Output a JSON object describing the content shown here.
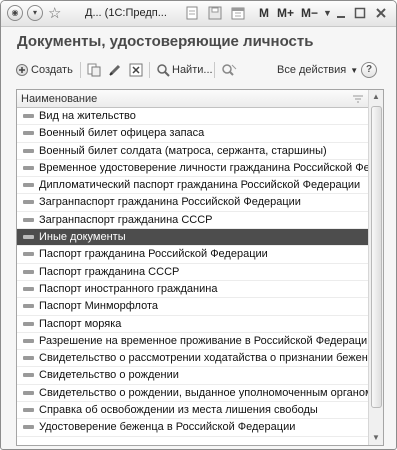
{
  "titlebar": {
    "title": "Д...  (1С:Предп...",
    "m_label": "M",
    "m_plus_label": "M+",
    "m_minus_label": "M−"
  },
  "heading": "Документы, удостоверяющие личность",
  "toolbar": {
    "create_label": "Создать",
    "find_label": "Найти...",
    "all_actions_label": "Все действия",
    "help_label": "?"
  },
  "list": {
    "column_header": "Наименование",
    "rows": [
      "Вид на жительство",
      "Военный билет офицера запаса",
      "Военный билет солдата (матроса, сержанта, старшины)",
      "Временное удостоверение личности гражданина Российской Фе...",
      "Дипломатический паспорт гражданина Российской Федерации",
      "Загранпаспорт гражданина Российской Федерации",
      "Загранпаспорт гражданина СССР",
      "Иные документы",
      "Паспорт гражданина Российской Федерации",
      "Паспорт гражданина СССР",
      "Паспорт иностранного гражданина",
      "Паспорт Минморфлота",
      "Паспорт моряка",
      "Разрешение на временное проживание в Российской Федерации",
      "Свидетельство о рассмотрении ходатайства о признании беженц...",
      "Свидетельство о рождении",
      "Свидетельство о рождении, выданное уполномоченным органом ...",
      "Справка об освобождении из места лишения свободы",
      "Удостоверение беженца в Российской Федерации"
    ],
    "selected_index": 7
  },
  "colors": {
    "selected_row": "#4d4d4d",
    "heading": "#4a4a4a"
  }
}
